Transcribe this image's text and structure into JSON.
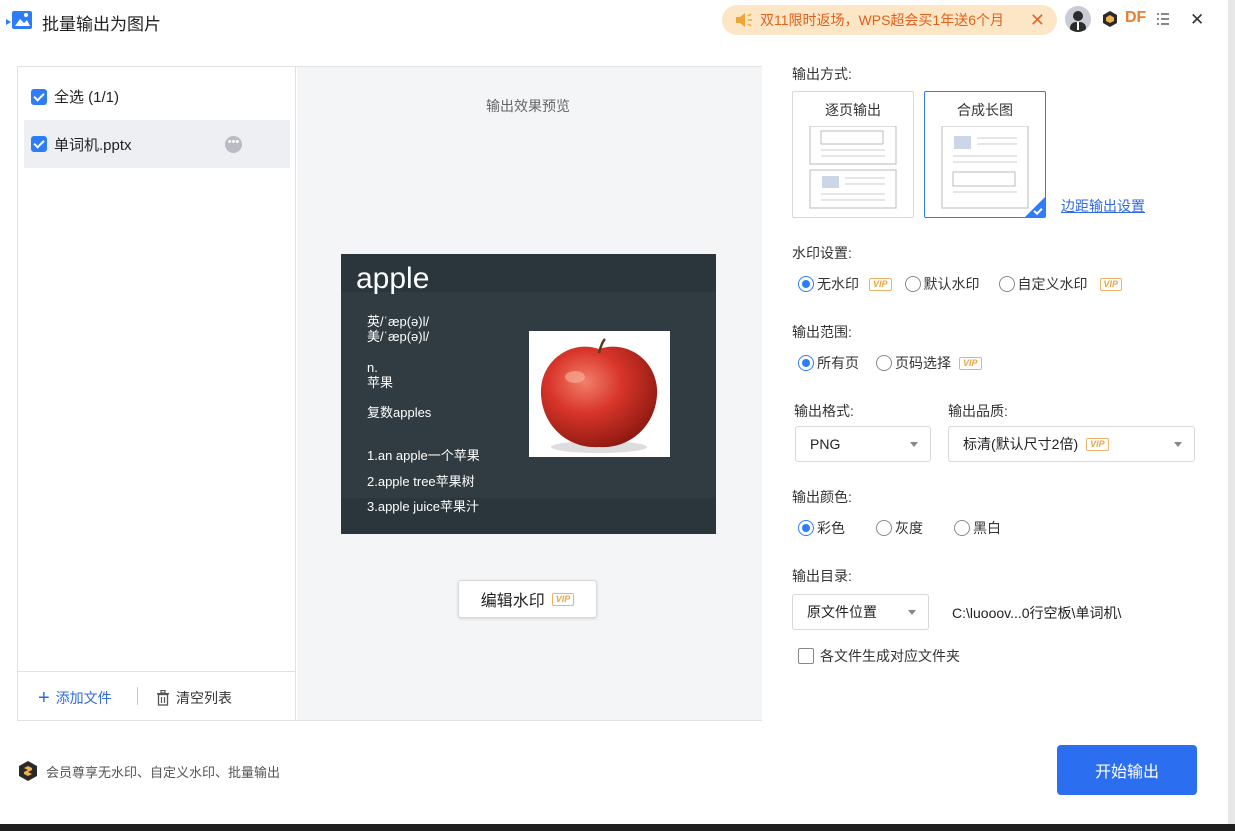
{
  "window": {
    "title": "批量输出为图片",
    "promo": "双11限时返场，WPS超会买1年送6个月",
    "user_initials": "DF"
  },
  "file_list": {
    "select_all": "全选 (1/1)",
    "files": [
      {
        "name": "单词机.pptx"
      }
    ],
    "add_file": "添加文件",
    "clear_list": "清空列表"
  },
  "preview": {
    "label": "输出效果预览",
    "slide": {
      "title": "apple",
      "phonetic_uk": "英/ˈæp(ə)l/",
      "phonetic_us": "美/ˈæp(ə)l/",
      "pos": "n.",
      "meaning": "苹果",
      "plural": "复数apples",
      "examples": [
        "1.an apple一个苹果",
        "2.apple tree苹果树",
        "3.apple juice苹果汁"
      ]
    },
    "edit_watermark": "编辑水印",
    "vip_badge": "VIP"
  },
  "settings": {
    "output_mode_label": "输出方式:",
    "modes": [
      "逐页输出",
      "合成长图"
    ],
    "selected_mode": "合成长图",
    "margin_link": "边距输出设置",
    "watermark_label": "水印设置:",
    "watermark_options": [
      "无水印",
      "默认水印",
      "自定义水印"
    ],
    "range_label": "输出范围:",
    "range_options": [
      "所有页",
      "页码选择"
    ],
    "format_label": "输出格式:",
    "format_value": "PNG",
    "quality_label": "输出品质:",
    "quality_value": "标清(默认尺寸2倍)",
    "color_label": "输出颜色:",
    "color_options": [
      "彩色",
      "灰度",
      "黑白"
    ],
    "dir_label": "输出目录:",
    "dir_value": "原文件位置",
    "dir_path": "C:\\luooov...0行空板\\单词机\\",
    "subfolder_option": "各文件生成对应文件夹"
  },
  "footer": {
    "note": "会员尊享无水印、自定义水印、批量输出",
    "start_button": "开始输出"
  },
  "colors": {
    "accent": "#2b6ff0",
    "promo_bg": "#fde6c6",
    "promo_text": "#e0611b",
    "vip": "#e9a544"
  }
}
